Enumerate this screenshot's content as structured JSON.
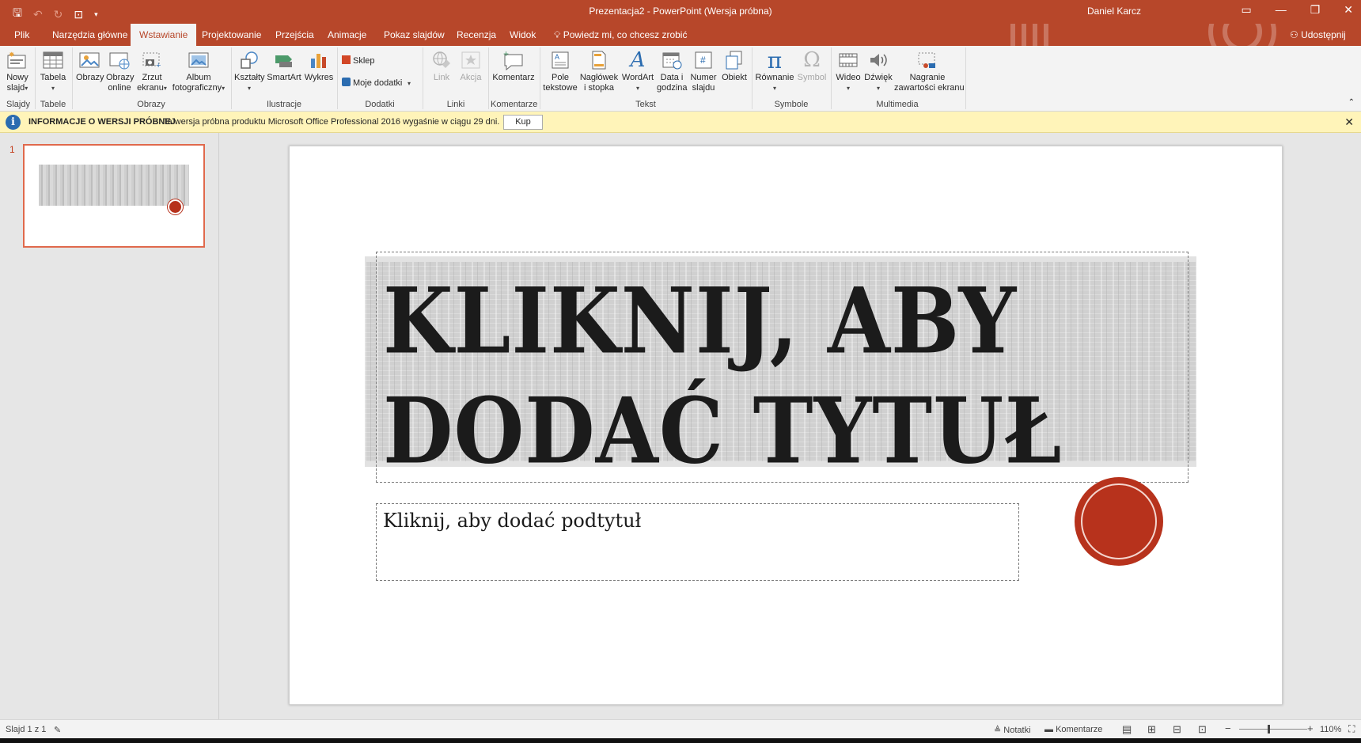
{
  "window": {
    "title": "Prezentacja2 -  PowerPoint (Wersja próbna)",
    "user": "Daniel Karcz",
    "qat_icons": [
      "save-icon",
      "undo-icon",
      "redo-icon",
      "start-from-beginning-icon",
      "customize-qat-icon"
    ],
    "controls": [
      "ribbon-display-options-icon",
      "minimize-icon",
      "restore-icon",
      "close-icon"
    ]
  },
  "tabs": [
    {
      "label": "Plik"
    },
    {
      "label": "Narzędzia główne"
    },
    {
      "label": "Wstawianie",
      "active": true
    },
    {
      "label": "Projektowanie"
    },
    {
      "label": "Przejścia"
    },
    {
      "label": "Animacje"
    },
    {
      "label": "Pokaz slajdów"
    },
    {
      "label": "Recenzja"
    },
    {
      "label": "Widok"
    }
  ],
  "tell_me": "Powiedz mi, co chcesz zrobić",
  "share": "Udostępnij",
  "ribbon": {
    "buttons": {
      "nowy_slajd": {
        "l1": "Nowy",
        "l2": "slajd"
      },
      "tabela": {
        "l1": "Tabela"
      },
      "obrazy": {
        "l1": "Obrazy"
      },
      "obrazy_online": {
        "l1": "Obrazy",
        "l2": "online"
      },
      "zrzut": {
        "l1": "Zrzut",
        "l2": "ekranu"
      },
      "album": {
        "l1": "Album",
        "l2": "fotograficzny"
      },
      "ksztalty": {
        "l1": "Kształty"
      },
      "smartart": {
        "l1": "SmartArt"
      },
      "wykres": {
        "l1": "Wykres"
      },
      "sklep": {
        "l1": "Sklep"
      },
      "moje_dodatki": {
        "l1": "Moje dodatki"
      },
      "link": {
        "l1": "Link"
      },
      "akcja": {
        "l1": "Akcja"
      },
      "komentarz": {
        "l1": "Komentarz"
      },
      "pole": {
        "l1": "Pole",
        "l2": "tekstowe"
      },
      "naglowek": {
        "l1": "Nagłówek",
        "l2": "i stopka"
      },
      "wordart": {
        "l1": "WordArt"
      },
      "data": {
        "l1": "Data i",
        "l2": "godzina"
      },
      "numer": {
        "l1": "Numer",
        "l2": "slajdu"
      },
      "obiekt": {
        "l1": "Obiekt"
      },
      "rownanie": {
        "l1": "Równanie"
      },
      "symbol": {
        "l1": "Symbol"
      },
      "wideo": {
        "l1": "Wideo"
      },
      "dzwiek": {
        "l1": "Dźwięk"
      },
      "nagranie": {
        "l1": "Nagranie",
        "l2": "zawartości ekranu"
      }
    },
    "groups": {
      "slajdy": "Slajdy",
      "tabele": "Tabele",
      "obrazy": "Obrazy",
      "ilustracje": "Ilustracje",
      "dodatki": "Dodatki",
      "linki": "Linki",
      "komentarze": "Komentarze",
      "tekst": "Tekst",
      "symbole": "Symbole",
      "multimedia": "Multimedia"
    },
    "glyphs": {
      "pi": "π",
      "omega": "Ω",
      "wordart": "A",
      "numer": "#"
    }
  },
  "infobar": {
    "title": "INFORMACJE O WERSJI PRÓBNEJ",
    "message": "Ta wersja próbna produktu Microsoft Office Professional 2016 wygaśnie w ciągu 29 dni.",
    "button": "Kup",
    "icon_letter": "i"
  },
  "thumbnails": [
    {
      "number": "1"
    }
  ],
  "slide": {
    "title": "KLIKNIJ, ABY DODAĆ TYTUŁ",
    "subtitle": "Kliknij, aby dodać podtytuł",
    "accent": "#b7321c"
  },
  "status": {
    "slide": "Slajd 1 z 1",
    "notes": "Notatki",
    "comments": "Komentarze",
    "zoom": "110%",
    "zoom_minus": "−",
    "zoom_plus": "+"
  },
  "colors": {
    "brand": "#b7472a",
    "infobar": "#fff4b9"
  }
}
